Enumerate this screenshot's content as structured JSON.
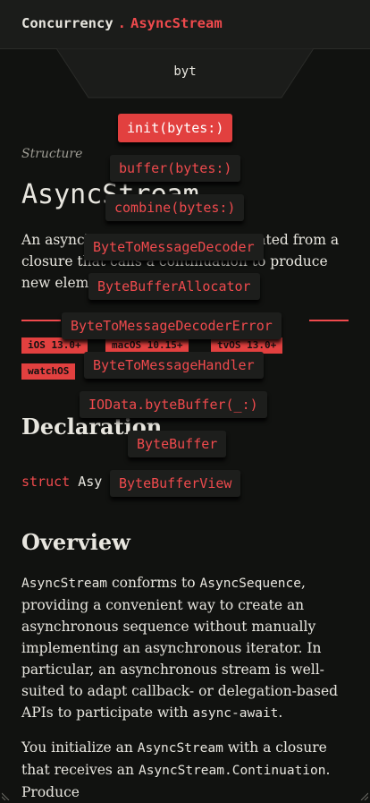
{
  "breadcrumb": {
    "parent": "Concurrency",
    "separator": ".",
    "current": "AsyncStream"
  },
  "search": {
    "value": "byt"
  },
  "suggestions": [
    {
      "label": "init(bytes:)",
      "active": true
    },
    {
      "label": "buffer(bytes:)"
    },
    {
      "label": "combine(bytes:)"
    },
    {
      "label": "ByteToMessageDecoder"
    },
    {
      "label": "ByteBufferAllocator"
    },
    {
      "label": "ByteToMessageDecoderError"
    },
    {
      "label": "ByteToMessageHandler"
    },
    {
      "label": "IOData.byteBuffer(_:)"
    },
    {
      "label": "ByteBuffer"
    },
    {
      "label": "ByteBufferView"
    }
  ],
  "page": {
    "kind": "Structure",
    "title": "AsyncStream",
    "summary": "An asynchronous sequence generated from a closure that calls a continuation to produce new elements.",
    "availability": [
      "iOS 13.0+",
      "macOS 10.15+",
      "tvOS 13.0+",
      "watchOS"
    ],
    "declaration_heading": "Declaration",
    "declaration": {
      "keyword": "struct",
      "name": "Asy"
    },
    "overview_heading": "Overview",
    "overview_p1": {
      "t1": "AsyncStream",
      "t2": " conforms to ",
      "t3": "AsyncSequence",
      "t4": ", providing a convenient way to create an asynchronous sequence without manually implementing an asynchronous iterator. In particular, an asynchronous stream is well-suited to adapt callback- or delegation-based APIs to participate with ",
      "t5": "async",
      "t6": "-",
      "t7": "await",
      "t8": "."
    },
    "overview_p2": {
      "t1": "You initialize an ",
      "t2": "AsyncStream",
      "t3": " with a closure that receives an ",
      "t4": "AsyncStream.Continuation",
      "t5": ". Produce"
    }
  },
  "colors": {
    "accent": "#ef4a4d",
    "background": "#111210",
    "text": "#e8e6df"
  }
}
